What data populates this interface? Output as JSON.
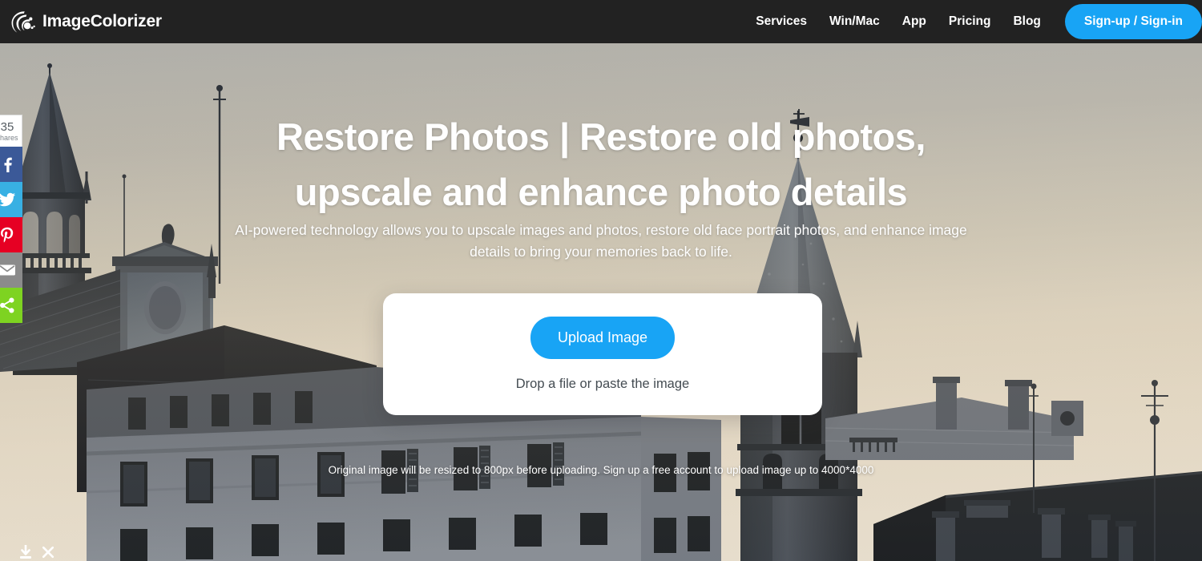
{
  "brand": {
    "name": "ImageColorizer",
    "logo_icon": "swoosh-arc-logo"
  },
  "header": {
    "background_color": "#222222",
    "nav_items": [
      {
        "label": "Services"
      },
      {
        "label": "Win/Mac"
      },
      {
        "label": "App"
      },
      {
        "label": "Pricing"
      },
      {
        "label": "Blog"
      }
    ],
    "signup_label": "Sign-up / Sign-in",
    "accent_color": "#18a4f5"
  },
  "hero": {
    "headline_line1": "Restore Photos | Restore old photos,",
    "headline_line2": "upscale and enhance photo details",
    "subheadline": "AI-powered technology allows you to upscale images and photos, restore old face portrait photos, and enhance image details to bring your memories back to life.",
    "resize_note": "Original image will be resized to 800px before uploading. Sign up a free account to upload image up to 4000*4000",
    "photo_description": "Black and white photo of old European town rooftops with a church spire and clock tower against a pale sky"
  },
  "upload": {
    "button_label": "Upload Image",
    "drop_hint": "Drop a file or paste the image",
    "button_color": "#18a4f5",
    "card_color": "#ffffff"
  },
  "share_rail": {
    "count": "35",
    "count_label": "shares",
    "buttons": [
      {
        "name": "facebook",
        "icon": "facebook-icon",
        "color": "#3b5998"
      },
      {
        "name": "twitter",
        "icon": "twitter-icon",
        "color": "#38b0e3"
      },
      {
        "name": "pinterest",
        "icon": "pinterest-icon",
        "color": "#e60023"
      },
      {
        "name": "email",
        "icon": "email-icon",
        "color": "#8b8b8b"
      },
      {
        "name": "sharethis",
        "icon": "share-nodes-icon",
        "color": "#7ed321"
      }
    ]
  },
  "bottom_widget": {
    "download_icon": "download-icon",
    "close_icon": "close-icon"
  }
}
